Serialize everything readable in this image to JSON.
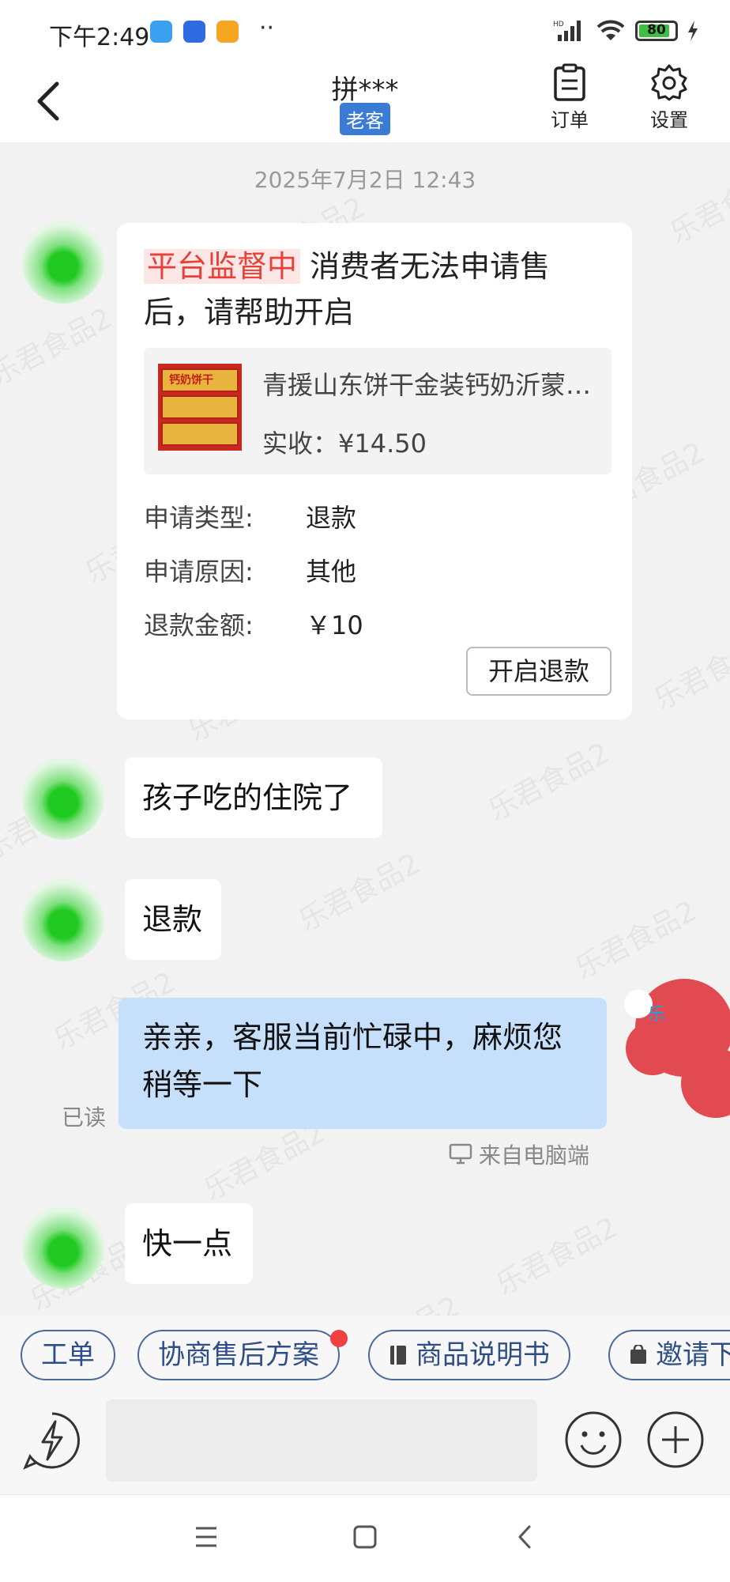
{
  "status_bar": {
    "time": "下午2:49",
    "battery": "80",
    "app_icon_colors": [
      "#3aa0f0",
      "#2f6be0",
      "#f5a623"
    ]
  },
  "header": {
    "title": "拼***",
    "tag": "老客",
    "order_label": "订单",
    "settings_label": "设置"
  },
  "timestamp": "2025年7月2日 12:43",
  "card": {
    "highlight": "平台监督中",
    "title_rest": " 消费者无法申请售后，请帮助开启",
    "product_name": "青援山东饼干金装钙奶沂蒙老式饼干",
    "product_price": "实收：¥14.50",
    "package_label": "钙奶饼干",
    "rows": [
      {
        "label": "申请类型:",
        "value": "退款"
      },
      {
        "label": "申请原因:",
        "value": "其他"
      },
      {
        "label": "退款金额:",
        "value": "￥10"
      }
    ],
    "button": "开启退款"
  },
  "messages": [
    {
      "text": "孩子吃的住院了"
    },
    {
      "text": "退款"
    },
    {
      "text": "亲亲，客服当前忙碌中，麻烦您稍等一下"
    },
    {
      "text": "快一点"
    }
  ],
  "read_label": "已读",
  "from_label": "来自电脑端",
  "agent_tag": "乐",
  "watermark": "乐君食品2",
  "quick_actions": [
    "工单",
    "协商售后方案",
    "商品说明书",
    "邀请下单"
  ],
  "colors": {
    "accent": "#3a7bd5",
    "highlight_red": "#e8413a",
    "bubble_blue": "#c6e0fb",
    "avatar_green": "#1fc91f"
  }
}
